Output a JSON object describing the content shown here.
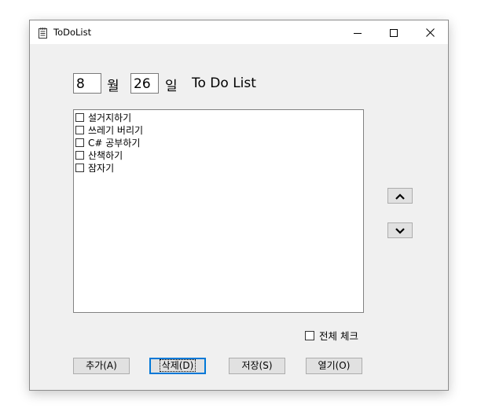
{
  "window": {
    "title": "ToDoList",
    "icon": "notepad-icon",
    "caption_buttons": [
      "minimize-icon",
      "maximize-icon",
      "close-icon"
    ]
  },
  "date": {
    "month": "8",
    "month_label": "월",
    "day": "26",
    "day_label": "일",
    "heading": "To Do List"
  },
  "todo_items": [
    {
      "label": "설거지하기",
      "checked": false
    },
    {
      "label": "쓰레기 버리기",
      "checked": false
    },
    {
      "label": "C# 공부하기",
      "checked": false
    },
    {
      "label": "산책하기",
      "checked": false
    },
    {
      "label": "잠자기",
      "checked": false
    }
  ],
  "reorder": {
    "up_icon": "chevron-up-icon",
    "down_icon": "chevron-down-icon"
  },
  "check_all": {
    "label": "전체 체크",
    "checked": false
  },
  "buttons": {
    "add": "추가(A)",
    "delete": "삭제(D)",
    "save": "저장(S)",
    "open": "열기(O)"
  },
  "colors": {
    "focus_accent": "#0078d7",
    "window_bg": "#f0f0f0"
  }
}
